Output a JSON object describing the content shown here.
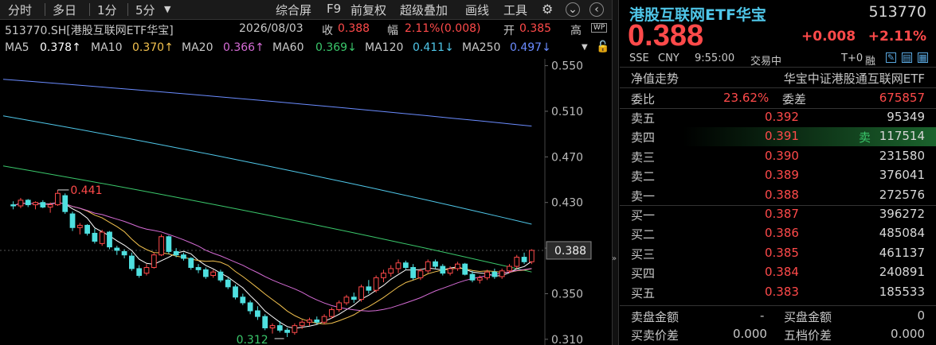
{
  "toolbar": {
    "left": [
      "分时",
      "多日",
      "1分",
      "5分"
    ],
    "right": [
      "综合屏",
      "F9",
      "前复权",
      "超级叠加",
      "画线",
      "工具"
    ]
  },
  "info": {
    "code": "513770.SH[港股互联网ETF华宝]",
    "date": "2026/08/03",
    "close_label": "收",
    "close": "0.388",
    "change_label": "幅",
    "change": "2.11%(0.008)",
    "open_label": "开",
    "open": "0.385",
    "high_label": "高",
    "wp_badge": "WP"
  },
  "ma": [
    {
      "label": "MA5",
      "value": "0.378↑",
      "color": "#ffffff"
    },
    {
      "label": "MA10",
      "value": "0.370↑",
      "color": "#f2c14e"
    },
    {
      "label": "MA20",
      "value": "0.366↑",
      "color": "#d66cd6"
    },
    {
      "label": "MA60",
      "value": "0.369↓",
      "color": "#3ac76b"
    },
    {
      "label": "MA120",
      "value": "0.411↓",
      "color": "#4fc6e8"
    },
    {
      "label": "MA250",
      "value": "0.497↓",
      "color": "#6b8cff"
    }
  ],
  "chart_data": {
    "type": "candlestick",
    "y_ticks": [
      "0.550",
      "0.510",
      "0.470",
      "0.430",
      "0.390",
      "0.350",
      "0.310"
    ],
    "ylim": [
      0.305,
      0.556
    ],
    "current_price_label": "0.388",
    "current_price": 0.388,
    "high_marker": {
      "label": "0.441",
      "value": 0.441,
      "index": 6
    },
    "low_marker": {
      "label": "0.312",
      "value": 0.312,
      "index": 37
    },
    "candles": [
      [
        0.428,
        0.431,
        0.424,
        0.427
      ],
      [
        0.427,
        0.434,
        0.425,
        0.432
      ],
      [
        0.432,
        0.433,
        0.426,
        0.428
      ],
      [
        0.428,
        0.431,
        0.424,
        0.43
      ],
      [
        0.43,
        0.432,
        0.425,
        0.426
      ],
      [
        0.426,
        0.43,
        0.421,
        0.428
      ],
      [
        0.428,
        0.441,
        0.427,
        0.438
      ],
      [
        0.436,
        0.438,
        0.42,
        0.422
      ],
      [
        0.42,
        0.422,
        0.405,
        0.408
      ],
      [
        0.408,
        0.412,
        0.402,
        0.41
      ],
      [
        0.41,
        0.411,
        0.401,
        0.403
      ],
      [
        0.403,
        0.407,
        0.394,
        0.396
      ],
      [
        0.394,
        0.406,
        0.392,
        0.404
      ],
      [
        0.404,
        0.405,
        0.389,
        0.391
      ],
      [
        0.39,
        0.392,
        0.384,
        0.388
      ],
      [
        0.387,
        0.389,
        0.381,
        0.384
      ],
      [
        0.383,
        0.386,
        0.37,
        0.372
      ],
      [
        0.372,
        0.375,
        0.364,
        0.366
      ],
      [
        0.368,
        0.376,
        0.366,
        0.373
      ],
      [
        0.373,
        0.386,
        0.372,
        0.384
      ],
      [
        0.384,
        0.402,
        0.383,
        0.4
      ],
      [
        0.4,
        0.401,
        0.385,
        0.387
      ],
      [
        0.387,
        0.39,
        0.382,
        0.384
      ],
      [
        0.384,
        0.386,
        0.379,
        0.381
      ],
      [
        0.381,
        0.382,
        0.371,
        0.373
      ],
      [
        0.373,
        0.376,
        0.368,
        0.371
      ],
      [
        0.371,
        0.373,
        0.363,
        0.365
      ],
      [
        0.366,
        0.371,
        0.364,
        0.369
      ],
      [
        0.369,
        0.371,
        0.36,
        0.362
      ],
      [
        0.362,
        0.364,
        0.354,
        0.356
      ],
      [
        0.356,
        0.358,
        0.345,
        0.347
      ],
      [
        0.347,
        0.35,
        0.34,
        0.342
      ],
      [
        0.342,
        0.344,
        0.332,
        0.335
      ],
      [
        0.335,
        0.339,
        0.327,
        0.33
      ],
      [
        0.33,
        0.332,
        0.318,
        0.32
      ],
      [
        0.32,
        0.324,
        0.315,
        0.322
      ],
      [
        0.322,
        0.326,
        0.316,
        0.318
      ],
      [
        0.318,
        0.32,
        0.312,
        0.316
      ],
      [
        0.316,
        0.324,
        0.314,
        0.322
      ],
      [
        0.322,
        0.327,
        0.319,
        0.325
      ],
      [
        0.325,
        0.329,
        0.322,
        0.327
      ],
      [
        0.327,
        0.33,
        0.323,
        0.325
      ],
      [
        0.325,
        0.332,
        0.323,
        0.33
      ],
      [
        0.33,
        0.338,
        0.328,
        0.336
      ],
      [
        0.336,
        0.344,
        0.334,
        0.342
      ],
      [
        0.342,
        0.349,
        0.34,
        0.347
      ],
      [
        0.347,
        0.351,
        0.342,
        0.345
      ],
      [
        0.345,
        0.358,
        0.343,
        0.356
      ],
      [
        0.356,
        0.362,
        0.35,
        0.353
      ],
      [
        0.353,
        0.366,
        0.351,
        0.364
      ],
      [
        0.364,
        0.371,
        0.36,
        0.368
      ],
      [
        0.368,
        0.375,
        0.365,
        0.372
      ],
      [
        0.372,
        0.38,
        0.368,
        0.377
      ],
      [
        0.377,
        0.379,
        0.371,
        0.373
      ],
      [
        0.373,
        0.376,
        0.362,
        0.364
      ],
      [
        0.364,
        0.372,
        0.362,
        0.37
      ],
      [
        0.37,
        0.38,
        0.368,
        0.378
      ],
      [
        0.378,
        0.38,
        0.372,
        0.374
      ],
      [
        0.374,
        0.376,
        0.366,
        0.368
      ],
      [
        0.368,
        0.374,
        0.366,
        0.372
      ],
      [
        0.372,
        0.378,
        0.37,
        0.376
      ],
      [
        0.376,
        0.377,
        0.366,
        0.367
      ],
      [
        0.367,
        0.37,
        0.36,
        0.362
      ],
      [
        0.362,
        0.366,
        0.359,
        0.364
      ],
      [
        0.364,
        0.371,
        0.362,
        0.369
      ],
      [
        0.369,
        0.372,
        0.363,
        0.365
      ],
      [
        0.365,
        0.372,
        0.363,
        0.37
      ],
      [
        0.37,
        0.376,
        0.368,
        0.374
      ],
      [
        0.374,
        0.384,
        0.372,
        0.382
      ],
      [
        0.382,
        0.386,
        0.376,
        0.378
      ],
      [
        0.378,
        0.389,
        0.376,
        0.388
      ]
    ],
    "ma_lines": {
      "MA250": {
        "color": "#6b8cff",
        "start": 0.538,
        "end": 0.497
      },
      "MA120": {
        "color": "#4fc6e8",
        "start": 0.506,
        "end": 0.411
      },
      "MA60": {
        "color": "#3ac76b",
        "start": 0.462,
        "end": 0.369
      }
    }
  },
  "quote": {
    "name": "港股互联网ETF华宝",
    "code": "513770",
    "price": "0.388",
    "change": "+0.008",
    "change_pct": "+2.11%",
    "exchange": "SSE",
    "currency": "CNY",
    "time": "9:55:00",
    "status": "交易中",
    "t0": "T+0",
    "margin": "融",
    "nav_label": "净值走势",
    "index_name": "华宝中证港股通互联网ETF",
    "weibi_label": "委比",
    "weibi": "23.62%",
    "weicha_label": "委差",
    "weicha": "675857",
    "sell_tag": "卖"
  },
  "asks": [
    {
      "label": "卖五",
      "price": "0.392",
      "vol": "95349"
    },
    {
      "label": "卖四",
      "price": "0.391",
      "vol": "117514"
    },
    {
      "label": "卖三",
      "price": "0.390",
      "vol": "231580"
    },
    {
      "label": "卖二",
      "price": "0.389",
      "vol": "376041"
    },
    {
      "label": "卖一",
      "price": "0.388",
      "vol": "272576"
    }
  ],
  "bids": [
    {
      "label": "买一",
      "price": "0.387",
      "vol": "396272"
    },
    {
      "label": "买二",
      "price": "0.386",
      "vol": "485084"
    },
    {
      "label": "买三",
      "price": "0.385",
      "vol": "461137"
    },
    {
      "label": "买四",
      "price": "0.384",
      "vol": "240891"
    },
    {
      "label": "买五",
      "price": "0.383",
      "vol": "185533"
    }
  ],
  "footer": {
    "sell_amount_label": "卖盘金额",
    "sell_amount": "-",
    "buy_amount_label": "买盘金额",
    "buy_amount": "0",
    "spread_label": "买卖价差",
    "spread": "0.000",
    "five_spread_label": "五档价差",
    "five_spread": "0.000"
  }
}
